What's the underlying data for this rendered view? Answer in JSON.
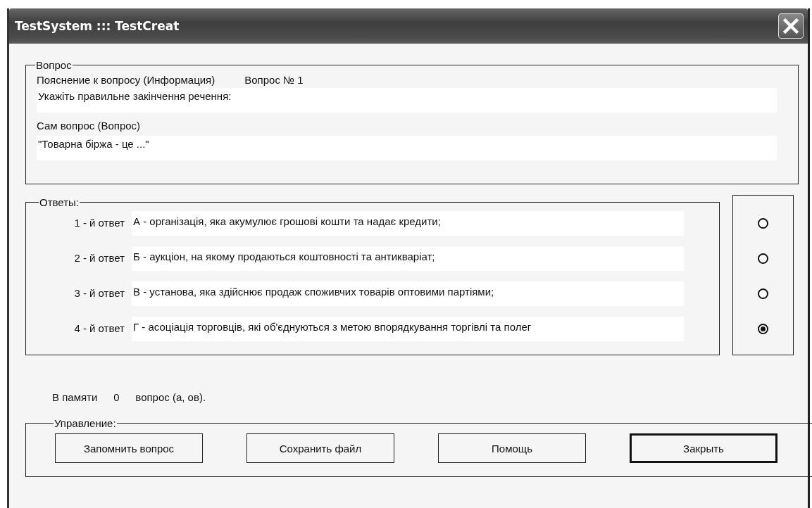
{
  "window": {
    "title": "TestSystem ::: TestCreat"
  },
  "question_group": {
    "legend": "Вопрос",
    "info_label": "Пояснение к вопросу (Информация)",
    "number_label": "Вопрос № 1",
    "info_value": "Укажіть правильне закінчення речення:",
    "question_label": "Сам вопрос (Вопрос)",
    "question_value": "\"Товарна біржа - це ...\""
  },
  "answers_group": {
    "legend": "Ответы:",
    "answers": [
      {
        "label": "1 - й ответ",
        "value": "А - організація, яка акумулює грошові кошти та надає кредити;",
        "selected": false
      },
      {
        "label": "2 - й ответ",
        "value": "Б - аукціон, на якому продаються коштовності та антикваріат;",
        "selected": false
      },
      {
        "label": "3 - й ответ",
        "value": "В - установа, яка здійснює продаж споживчих товарів оптовими партіями;",
        "selected": false
      },
      {
        "label": "4 - й ответ",
        "value": "Г - асоціація торговців, які об'єднуються з метою впорядкування торгівлі та полег",
        "selected": true
      }
    ]
  },
  "memory": {
    "prefix": "В памяти",
    "count": "0",
    "suffix": "вопрос (а, ов)."
  },
  "controls_group": {
    "legend": "Управление:",
    "buttons": [
      {
        "label": "Запомнить вопрос",
        "default": false
      },
      {
        "label": "Сохранить файл",
        "default": false
      },
      {
        "label": "Помощь",
        "default": false
      },
      {
        "label": "Закрыть",
        "default": true
      }
    ]
  }
}
